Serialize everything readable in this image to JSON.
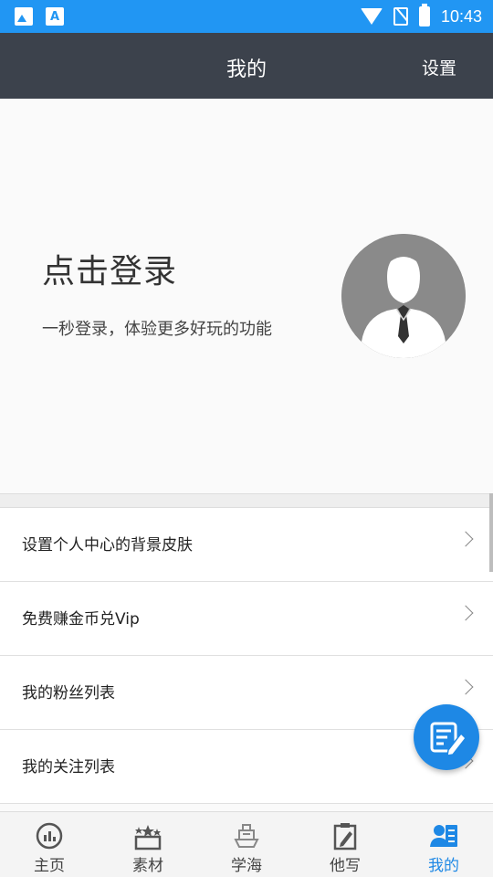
{
  "status_bar": {
    "time": "10:43",
    "icons": [
      "image-icon",
      "text-a-icon",
      "wifi-icon",
      "no-sim-icon",
      "battery-charging-icon"
    ]
  },
  "app_bar": {
    "title": "我的",
    "settings_label": "设置"
  },
  "profile": {
    "login_title": "点击登录",
    "login_subtitle": "一秒登录，体验更多好玩的功能",
    "avatar_icon": "default-avatar-icon"
  },
  "menu": {
    "items": [
      {
        "label": "设置个人中心的背景皮肤"
      },
      {
        "label": "免费赚金币兑Vip"
      },
      {
        "label": "我的粉丝列表"
      },
      {
        "label": "我的关注列表"
      }
    ]
  },
  "fab": {
    "icon": "edit-note-icon"
  },
  "tabbar": {
    "tabs": [
      {
        "label": "主页",
        "icon": "chart-circle-icon"
      },
      {
        "label": "素材",
        "icon": "stars-box-icon"
      },
      {
        "label": "学海",
        "icon": "ship-icon"
      },
      {
        "label": "他写",
        "icon": "clipboard-pen-icon"
      },
      {
        "label": "我的",
        "icon": "user-profile-icon",
        "active": true
      }
    ]
  },
  "colors": {
    "status_bar": "#2196f3",
    "app_bar": "#3c424c",
    "accent": "#1e88e5"
  }
}
